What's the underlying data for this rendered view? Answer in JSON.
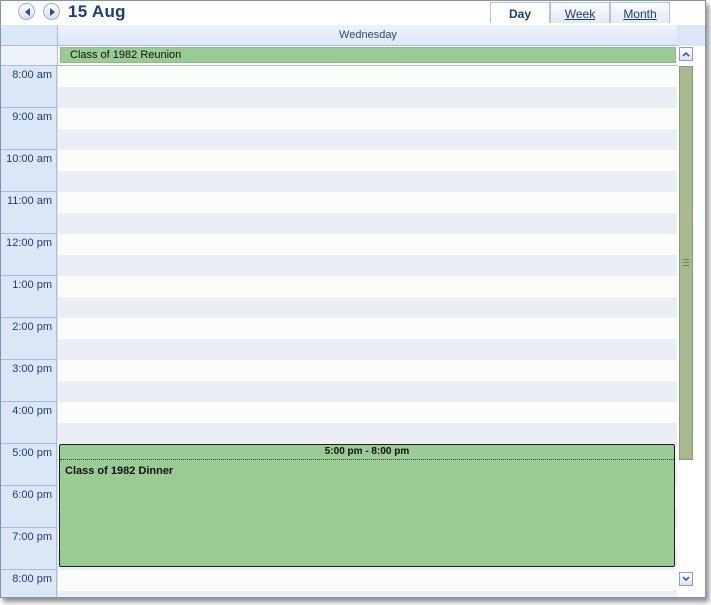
{
  "header": {
    "date_title": "15 Aug",
    "prev_icon": "arrow-left-icon",
    "next_icon": "arrow-right-icon",
    "views": [
      {
        "label": "Day",
        "active": true
      },
      {
        "label": "Week",
        "active": false
      },
      {
        "label": "Month",
        "active": false
      }
    ]
  },
  "day": {
    "name": "Wednesday"
  },
  "all_day_events": [
    {
      "title": "Class of 1982 Reunion",
      "color": "#9bcb94"
    }
  ],
  "time_labels": [
    "8:00 am",
    "9:00 am",
    "10:00 am",
    "11:00 am",
    "12:00 pm",
    "1:00 pm",
    "2:00 pm",
    "3:00 pm",
    "4:00 pm",
    "5:00 pm",
    "6:00 pm",
    "7:00 pm",
    "8:00 pm"
  ],
  "events": [
    {
      "time_range": "5:00 pm - 8:00 pm",
      "title": "Class of 1982 Dinner",
      "color": "#9bcb94"
    }
  ],
  "colors": {
    "accent_text": "#1f3b7a",
    "event_green": "#9bcb94",
    "scroll_thumb": "#a8b98f"
  }
}
